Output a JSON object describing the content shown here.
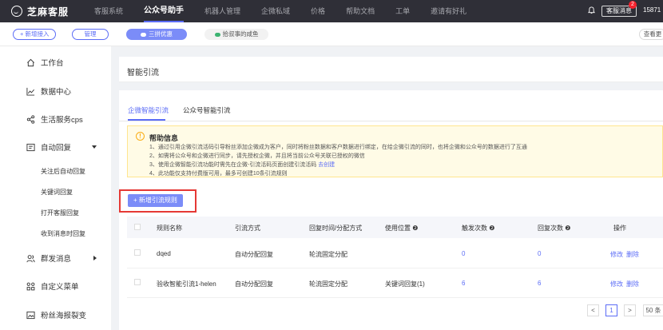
{
  "topnav": {
    "brand": "芝麻客服",
    "items": [
      "客服系统",
      "公众号助手",
      "机器人管理",
      "企微私域",
      "价格",
      "帮助文档",
      "工单",
      "邀请有好礼"
    ],
    "active_index": 1,
    "service_msg": "客服消息",
    "badge_count": "2",
    "user_phone": "15871"
  },
  "toolbar": {
    "add_label": "+ 新增接入",
    "manage_label": "管理",
    "account1": "三拼优惠",
    "account2": "拾叔事的咸鱼",
    "right_label": "查看更"
  },
  "sidebar": {
    "items": [
      {
        "label": "工作台",
        "icon": "home-icon"
      },
      {
        "label": "数据中心",
        "icon": "chart-icon"
      },
      {
        "label": "生活服务cps",
        "icon": "share-icon"
      },
      {
        "label": "自动回复",
        "icon": "message-icon"
      },
      {
        "label": "群发消息",
        "icon": "users-icon"
      },
      {
        "label": "自定义菜单",
        "icon": "grid-icon"
      },
      {
        "label": "粉丝海报裂变",
        "icon": "image-icon"
      }
    ],
    "subitems": [
      "关注后自动回复",
      "关键词回复",
      "打开客服回复",
      "收到消息时回复"
    ]
  },
  "main": {
    "title": "智能引流",
    "tabs": [
      "企微智能引流",
      "公众号智能引流"
    ],
    "help": {
      "title": "帮助信息",
      "lines": [
        "1、通过引用企微引流活码引导粉丝添加企微成为客户，同时将粉丝数据和客户数据进行绑定，在给企微引流的同时，也将企微和公众号的数据进行了互通",
        "2、如需将公众号和企微进行同步，请先授权企微，并且将当前公众号关联已授权的微信",
        "3、使用企微智能引流功能时需先在企微-引流活码页面创建引流活码",
        "4、此功能仅支持付费版可用，最多可创建10条引流规则"
      ],
      "link": "去创建"
    },
    "add_rule": "+ 新增引流规则",
    "table": {
      "headers": [
        "规则名称",
        "引流方式",
        "回复时间/分配方式",
        "使用位置 ❷",
        "触发次数 ❷",
        "回复次数 ❷",
        "操作"
      ],
      "rows": [
        {
          "name": "dqed",
          "method": "自动分配回复",
          "time": "轮流固定分配",
          "position": "",
          "trigger": "0",
          "reply": "0"
        },
        {
          "name": "验收智能引流1-helen",
          "method": "自动分配回复",
          "time": "轮流固定分配",
          "position": "关键词回复(1)",
          "trigger": "6",
          "reply": "6"
        }
      ],
      "actions": [
        "修改",
        "删除"
      ]
    },
    "pagination": {
      "prev": "<",
      "page": "1",
      "next": ">",
      "size": "50 条"
    }
  }
}
